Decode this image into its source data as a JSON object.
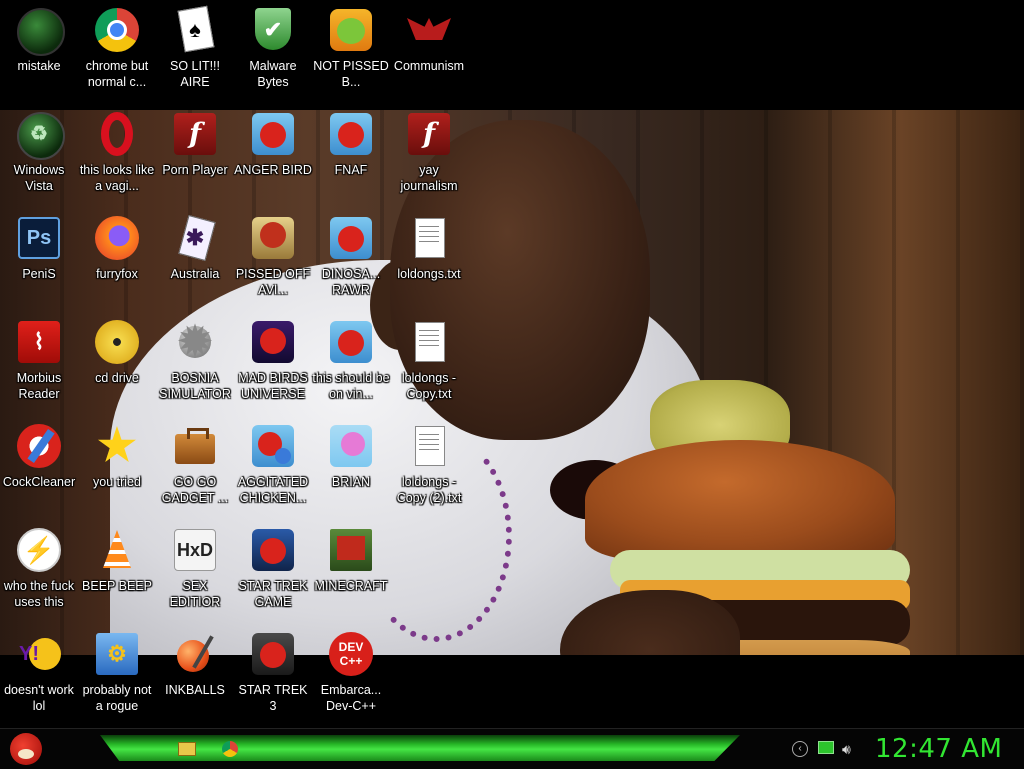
{
  "desktop": {
    "icons": [
      {
        "id": "mistake",
        "label": "mistake",
        "icon": "green-orb-icon"
      },
      {
        "id": "chrome",
        "label": "chrome but normal c...",
        "icon": "chrome-icon"
      },
      {
        "id": "solit",
        "label": "SO LIT!!! AIRE",
        "icon": "playing-card-icon"
      },
      {
        "id": "malware",
        "label": "Malware Bytes",
        "icon": "shield-check-icon"
      },
      {
        "id": "notpissed",
        "label": "NOT PISSED B...",
        "icon": "green-pig-icon"
      },
      {
        "id": "communism",
        "label": "Communism",
        "icon": "red-emblem-icon"
      },
      {
        "id": "vista",
        "label": "Windows Vista",
        "icon": "recycle-orb-icon"
      },
      {
        "id": "opera",
        "label": "this looks like a vagi...",
        "icon": "opera-icon"
      },
      {
        "id": "pornplayer",
        "label": "Porn Player",
        "icon": "flash-icon"
      },
      {
        "id": "angerbird",
        "label": "ANGER BIRD",
        "icon": "red-bird-icon"
      },
      {
        "id": "fnaf",
        "label": "FNAF",
        "icon": "red-bird-icon"
      },
      {
        "id": "yayjournalism",
        "label": "yay journalism",
        "icon": "flash-icon"
      },
      {
        "id": "penis",
        "label": "PeniS",
        "icon": "photoshop-icon"
      },
      {
        "id": "furryfox",
        "label": "furryfox",
        "icon": "firefox-icon"
      },
      {
        "id": "australia",
        "label": "Australia",
        "icon": "spider-solitaire-icon"
      },
      {
        "id": "pissedoff",
        "label": "PISSED OFF AVI...",
        "icon": "seasons-bird-icon"
      },
      {
        "id": "dinosa",
        "label": "DINOSA... RAWR",
        "icon": "red-bird-icon"
      },
      {
        "id": "loldongs1",
        "label": "loldongs.txt",
        "icon": "text-file-icon"
      },
      {
        "id": "morbius",
        "label": "Morbius Reader",
        "icon": "acrobat-icon"
      },
      {
        "id": "cddrive",
        "label": "cd drive",
        "icon": "cd-icon"
      },
      {
        "id": "bosnia",
        "label": "BOSNIA SIMULATOR",
        "icon": "spiky-mine-icon"
      },
      {
        "id": "madbirds",
        "label": "MAD BIRDS UNIVERSE",
        "icon": "space-bird-icon"
      },
      {
        "id": "vinyl",
        "label": "this should be on vin...",
        "icon": "red-bird-icon"
      },
      {
        "id": "loldongs2",
        "label": "loldongs - Copy.txt",
        "icon": "text-file-icon"
      },
      {
        "id": "cockcleaner",
        "label": "CockCleaner",
        "icon": "ccleaner-icon"
      },
      {
        "id": "youtried",
        "label": "you tried",
        "icon": "star-icon"
      },
      {
        "id": "gogogadget",
        "label": "GO GO GADGET ...",
        "icon": "briefcase-icon"
      },
      {
        "id": "aggitated",
        "label": "AGGITATED CHICKEN...",
        "icon": "rio-bird-icon"
      },
      {
        "id": "brian",
        "label": "BRIAN",
        "icon": "slingshot-icon"
      },
      {
        "id": "loldongs3",
        "label": "loldongs - Copy (2).txt",
        "icon": "text-file-icon"
      },
      {
        "id": "whothefuck",
        "label": "who the fuck uses this",
        "icon": "lightning-icon"
      },
      {
        "id": "beepbeep",
        "label": "BEEP BEEP",
        "icon": "vlc-cone-icon"
      },
      {
        "id": "sexeditor",
        "label": "SEX EDITIOR",
        "icon": "hxd-icon"
      },
      {
        "id": "startrekgame",
        "label": "STAR TREK GAME",
        "icon": "star-wars-bird-icon"
      },
      {
        "id": "minecraft",
        "label": "MINECRAFT",
        "icon": "minecraft-icon"
      },
      {
        "id": "doesntwork",
        "label": "doesn't work lol",
        "icon": "yahoo-messenger-icon"
      },
      {
        "id": "rogue",
        "label": "probably not a rogue",
        "icon": "gears-monitor-icon"
      },
      {
        "id": "inkballs",
        "label": "INKBALLS",
        "icon": "ink-ball-icon"
      },
      {
        "id": "startrek3",
        "label": "STAR TREK 3",
        "icon": "star-wars-bird-icon"
      },
      {
        "id": "devcpp",
        "label": "Embarca... Dev-C++",
        "icon": "dev-cpp-icon"
      }
    ]
  },
  "taskbar": {
    "start_icon": "angry-bird-start-icon",
    "pinned": [
      {
        "name": "file-explorer-icon",
        "color": "#e8c84a"
      },
      {
        "name": "chrome-icon",
        "color": "#e8453c"
      }
    ],
    "tray": [
      "back-arrow-icon",
      "network-icon",
      "volume-icon"
    ],
    "clock": "12:47 AM"
  },
  "colors": {
    "clock": "#32e632",
    "taskbar_strip": "#26b526",
    "desktop_bg": "#000000"
  }
}
